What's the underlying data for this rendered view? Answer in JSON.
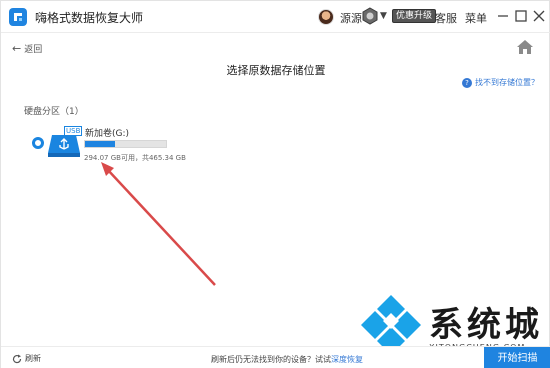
{
  "app": {
    "title": "嗨格式数据恢复大师"
  },
  "user": {
    "name": "源源",
    "promo": "优惠升级"
  },
  "menu": {
    "service": "客服",
    "main_menu": "菜单"
  },
  "nav": {
    "back": "返回",
    "page_title": "选择原数据存储位置",
    "help": "找不到存储位置？"
  },
  "section": {
    "label": "硬盘分区（1）"
  },
  "partitions": [
    {
      "name": "新加卷(G:)",
      "tag": "USB",
      "size_text": "294.07 GB可用，共465.34 GB",
      "used_fraction": 0.37
    }
  ],
  "footer": {
    "refresh": "刷新",
    "note": "刷新后仍无法找到你的设备？试试",
    "note_link": "深度恢复",
    "scan_button": "开始扫描"
  },
  "watermark": {
    "text": "系统城",
    "sub": "XITONGCHENG.COM"
  },
  "colors": {
    "accent": "#1f84e0",
    "link": "#3478d4",
    "arrow": "#d94a4a"
  }
}
